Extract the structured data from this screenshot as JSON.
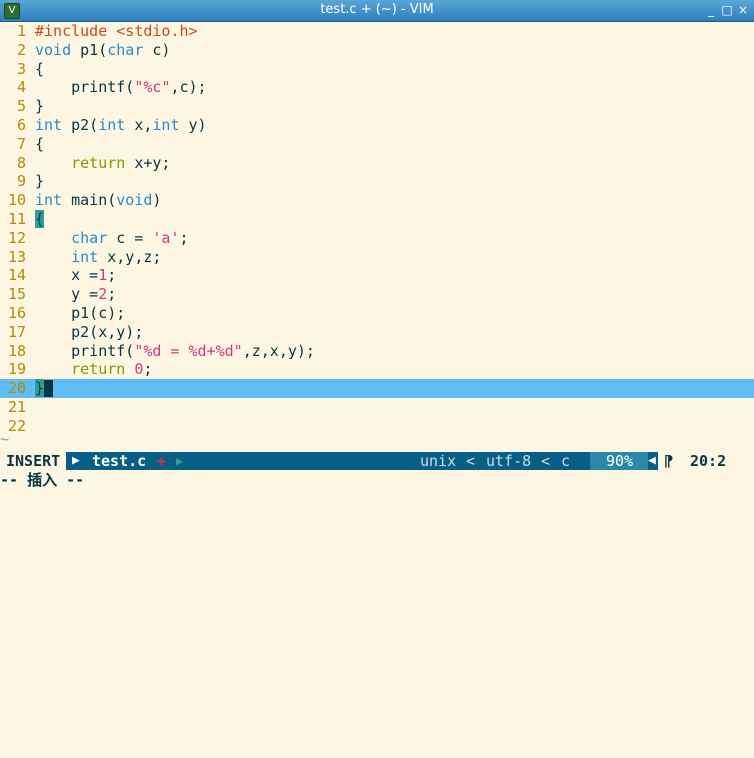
{
  "window": {
    "title": "test.c + (~) - VIM",
    "buttons": [
      "_",
      "□",
      "×"
    ]
  },
  "lines": [
    {
      "num": "1",
      "parts": [
        [
          "kw-inc",
          "#include <stdio.h>"
        ]
      ]
    },
    {
      "num": "2",
      "parts": [
        [
          "kw-type",
          "void"
        ],
        [
          "code",
          " p1("
        ],
        [
          "kw-type",
          "char"
        ],
        [
          "code",
          " c)"
        ]
      ]
    },
    {
      "num": "3",
      "parts": [
        [
          "code",
          "{"
        ]
      ]
    },
    {
      "num": "4",
      "parts": [
        [
          "code",
          "    printf("
        ],
        [
          "str",
          "\"%c\""
        ],
        [
          "code",
          ",c);"
        ]
      ]
    },
    {
      "num": "5",
      "parts": [
        [
          "code",
          "}"
        ]
      ]
    },
    {
      "num": "6",
      "parts": [
        [
          "kw-type",
          "int"
        ],
        [
          "code",
          " p2("
        ],
        [
          "kw-type",
          "int"
        ],
        [
          "code",
          " x,"
        ],
        [
          "kw-type",
          "int"
        ],
        [
          "code",
          " y)"
        ]
      ]
    },
    {
      "num": "7",
      "parts": [
        [
          "code",
          "{"
        ]
      ]
    },
    {
      "num": "8",
      "parts": [
        [
          "code",
          "    "
        ],
        [
          "kw-ret",
          "return"
        ],
        [
          "code",
          " x+y;"
        ]
      ]
    },
    {
      "num": "9",
      "parts": [
        [
          "code",
          "}"
        ]
      ]
    },
    {
      "num": "10",
      "parts": [
        [
          "kw-type",
          "int"
        ],
        [
          "code",
          " main("
        ],
        [
          "kw-type",
          "void"
        ],
        [
          "code",
          ")"
        ]
      ]
    },
    {
      "num": "11",
      "parts": [
        [
          "brace-hl",
          "{"
        ]
      ]
    },
    {
      "num": "12",
      "parts": [
        [
          "code",
          "    "
        ],
        [
          "kw-type",
          "char"
        ],
        [
          "code",
          " c = "
        ],
        [
          "str",
          "'a'"
        ],
        [
          "code",
          ";"
        ]
      ]
    },
    {
      "num": "13",
      "parts": [
        [
          "code",
          "    "
        ],
        [
          "kw-type",
          "int"
        ],
        [
          "code",
          " x,y,z;"
        ]
      ]
    },
    {
      "num": "14",
      "parts": [
        [
          "code",
          "    x ="
        ],
        [
          "num",
          "1"
        ],
        [
          "code",
          ";"
        ]
      ]
    },
    {
      "num": "15",
      "parts": [
        [
          "code",
          "    y ="
        ],
        [
          "num",
          "2"
        ],
        [
          "code",
          ";"
        ]
      ]
    },
    {
      "num": "16",
      "parts": [
        [
          "code",
          "    p1(c);"
        ]
      ]
    },
    {
      "num": "17",
      "parts": [
        [
          "code",
          "    p2(x,y);"
        ]
      ]
    },
    {
      "num": "18",
      "parts": [
        [
          "code",
          "    printf("
        ],
        [
          "str",
          "\"%d = %d+%d\""
        ],
        [
          "code",
          ",z,x,y);"
        ]
      ]
    },
    {
      "num": "19",
      "parts": [
        [
          "code",
          "    "
        ],
        [
          "kw-ret",
          "return"
        ],
        [
          "code",
          " "
        ],
        [
          "num",
          "0"
        ],
        [
          "code",
          ";"
        ]
      ]
    },
    {
      "num": "20",
      "parts": [
        [
          "brace-hl",
          "}"
        ]
      ],
      "current": true,
      "cursor": true
    },
    {
      "num": "21",
      "parts": []
    },
    {
      "num": "22",
      "parts": []
    }
  ],
  "tilde": "~",
  "statusline": {
    "mode": "INSERT",
    "file_arrow": "▶",
    "filename": "test.c",
    "modified": "+",
    "sep_arrow": "▶",
    "fileformat": "unix",
    "sep_left1": "<",
    "encoding": "utf-8",
    "sep_left2": "<",
    "filetype": "c",
    "percent": "90%",
    "sep_left3": "◀",
    "line_icon": "⁋",
    "position": "20:2"
  },
  "cmdline": "-- 插入 --",
  "colors": {
    "background": "#fdf6e3",
    "current_line": "#5fbcf5",
    "statusline": "#075f86",
    "titlebar": "#2f7fbd"
  }
}
